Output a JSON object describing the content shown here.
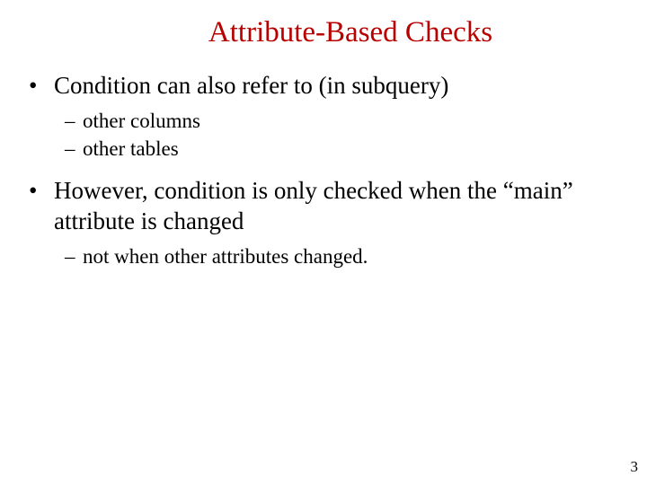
{
  "title": "Attribute-Based Checks",
  "title_color": "#B80000",
  "bullets": [
    {
      "text": "Condition can also refer to (in subquery)",
      "subs": [
        "other columns",
        "other tables"
      ]
    },
    {
      "text": "However, condition is only checked when the “main” attribute is changed",
      "subs": [
        "not when other attributes changed."
      ]
    }
  ],
  "page_number": "3"
}
